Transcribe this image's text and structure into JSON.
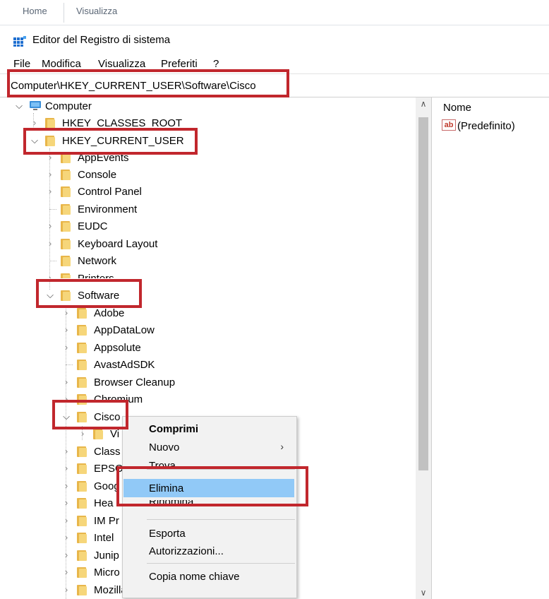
{
  "ribbon": {
    "tabs": [
      "Home",
      "Visualizza"
    ]
  },
  "window": {
    "title": "Editor del Registro di sistema"
  },
  "menu": {
    "items": [
      "File",
      "Modifica",
      "Visualizza",
      "Preferiti",
      "?"
    ]
  },
  "address": {
    "path": "Computer\\HKEY_CURRENT_USER\\Software\\Cisco"
  },
  "tree": {
    "root": "Computer",
    "hkcr": "HKEY_CLASSES_ROOT",
    "hkcu": "HKEY_CURRENT_USER",
    "hkcu_children": [
      "AppEvents",
      "Console",
      "Control Panel",
      "Environment",
      "EUDC",
      "Keyboard Layout",
      "Network",
      "Printers",
      "Software"
    ],
    "software_children": [
      "Adobe",
      "AppDataLow",
      "Appsolute",
      "AvastAdSDK",
      "Browser Cleanup",
      "Chromium",
      "Cisco",
      "Class",
      "EPSO",
      "Goog",
      "Hea",
      "IM Pr",
      "Intel",
      "Junip",
      "Micro",
      "Mozilla"
    ],
    "cisco_child": "Vi"
  },
  "right_pane": {
    "column": "Nome",
    "value_icon": "ab",
    "value_name": "(Predefinito)"
  },
  "context_menu": {
    "collapse": "Comprimi",
    "new": "Nuovo",
    "find": "Trova",
    "delete": "Elimina",
    "rename": "Rinomina",
    "export": "Esporta",
    "permissions": "Autorizzazioni...",
    "copy_key": "Copia nome chiave"
  },
  "colors": {
    "highlight_frame": "#c1272d",
    "menu_selection": "#91c9f7",
    "folder": "#f6d67a"
  }
}
